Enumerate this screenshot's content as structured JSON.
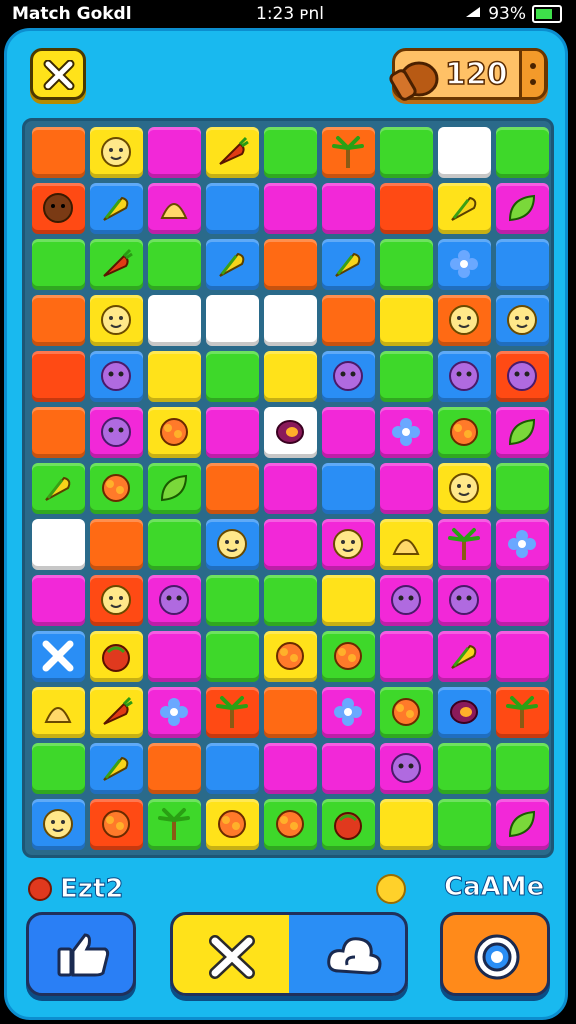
{
  "status_bar": {
    "left": "Match Gokdl",
    "time": "1:23 ᴘnl",
    "battery": "93%",
    "icons": [
      "wifi-icon",
      "signal-icon",
      "battery-icon"
    ]
  },
  "header": {
    "close_icon": "close-icon",
    "coin_value": "120",
    "coin_icon": "coin-bag-icon",
    "more_icon": "more-dots-icon"
  },
  "colors": {
    "orange": "#ff6a14",
    "yellow": "#ffe21a",
    "magenta": "#f228d8",
    "green": "#3ed82a",
    "blue": "#2a8ef5",
    "white": "#ffffff",
    "red": "#ff4a14"
  },
  "board": {
    "rows": 13,
    "cols": 9,
    "tiles": [
      [
        "orange",
        "yellow:face",
        "magenta",
        "yellow:carrot",
        "green",
        "orange:palm",
        "green",
        "white",
        "green"
      ],
      [
        "red:monkey",
        "blue:corn",
        "magenta:shell",
        "blue",
        "magenta",
        "magenta",
        "red",
        "yellow:corn",
        "magenta:leaf"
      ],
      [
        "green",
        "green:carrot",
        "green",
        "blue:corn",
        "orange",
        "blue:corn",
        "green",
        "blue:flower",
        "blue"
      ],
      [
        "orange",
        "yellow:face",
        "white",
        "white",
        "white",
        "orange",
        "yellow",
        "orange:face",
        "blue:face"
      ],
      [
        "red",
        "blue:monster",
        "yellow",
        "green",
        "yellow",
        "blue:monster",
        "green",
        "blue:monster",
        "red:monster"
      ],
      [
        "orange",
        "magenta:monster",
        "yellow:bush",
        "magenta",
        "white:plum",
        "magenta",
        "magenta:flower",
        "green:bush",
        "magenta:leaf"
      ],
      [
        "green:corn",
        "green:bush",
        "green:leaf",
        "orange",
        "magenta",
        "blue",
        "magenta",
        "yellow:face",
        "green"
      ],
      [
        "white",
        "orange",
        "green",
        "blue:face",
        "magenta",
        "magenta:face",
        "yellow:shell",
        "magenta:palm",
        "magenta:flower"
      ],
      [
        "magenta",
        "red:face",
        "magenta:monster",
        "green",
        "green",
        "yellow",
        "magenta:monster",
        "magenta:monster",
        "magenta"
      ],
      [
        "blue:x",
        "yellow:fruit",
        "magenta",
        "green",
        "yellow:bush",
        "green:bush",
        "magenta",
        "magenta:corn",
        "magenta"
      ],
      [
        "yellow:shell",
        "yellow:carrot",
        "magenta:flower",
        "red:palm",
        "orange",
        "magenta:flower",
        "green:bush",
        "blue:plum",
        "red:palm"
      ],
      [
        "green",
        "blue:corn",
        "orange",
        "blue",
        "magenta",
        "magenta",
        "magenta:monster",
        "green",
        "green"
      ],
      [
        "blue:face",
        "red:bush",
        "green:palm",
        "yellow:bush",
        "green:bush",
        "green:fruit",
        "yellow",
        "green",
        "magenta:leaf"
      ]
    ]
  },
  "footer": {
    "left_label": "Ezt2",
    "left_icon": "red-gem-icon",
    "coin_icon": "coin-icon",
    "right_label": "CaAMe",
    "buttons": [
      {
        "icon": "thumbs-up-icon"
      },
      {
        "icon": "close-icon"
      },
      {
        "icon": "cloud-icon"
      },
      {
        "icon": "gear-icon"
      }
    ]
  }
}
